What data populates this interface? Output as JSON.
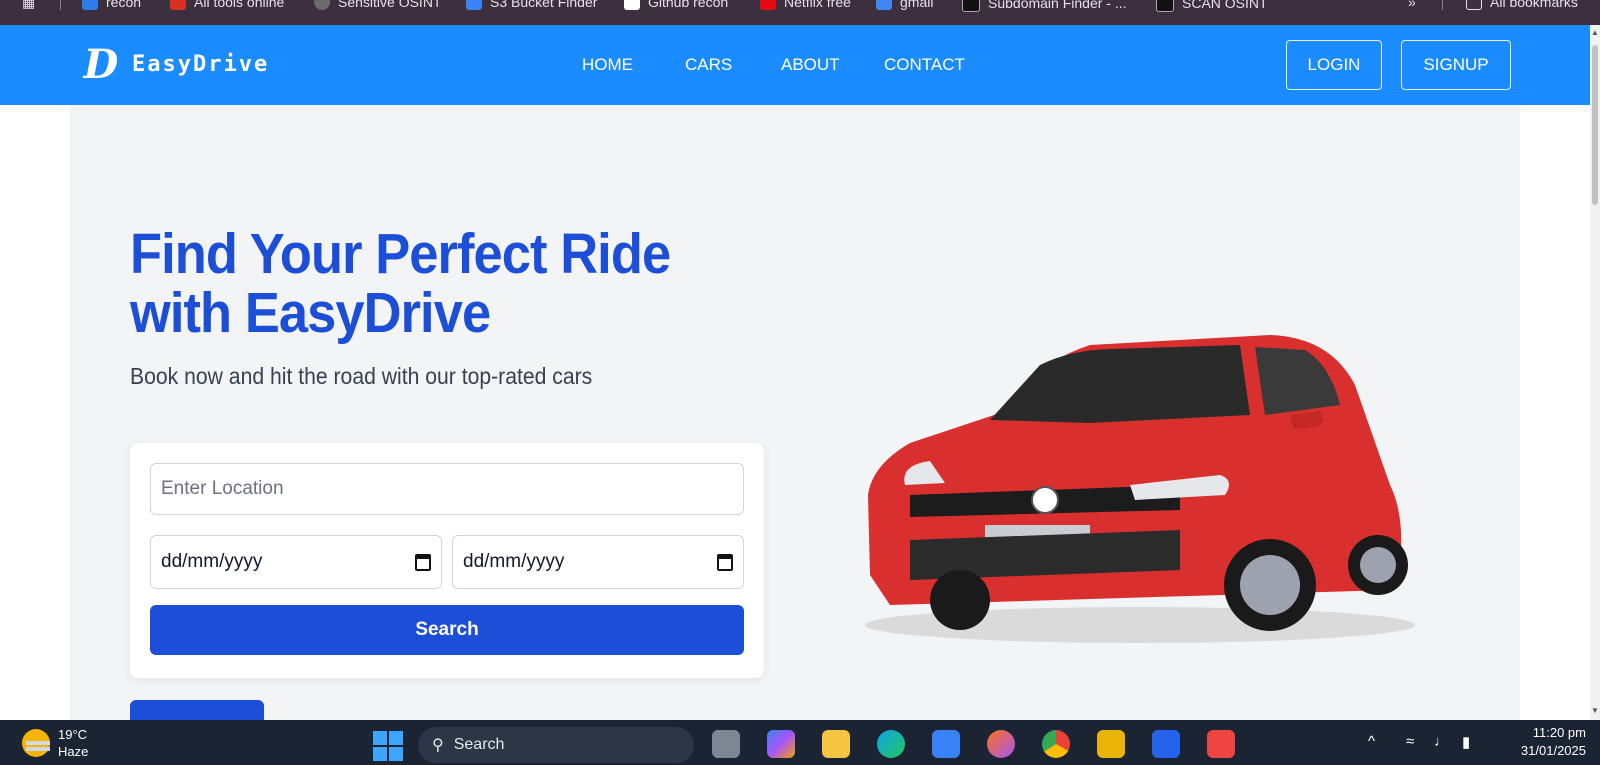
{
  "bookmarks": [
    {
      "label": "recon",
      "color": "#2b7de9"
    },
    {
      "label": "All tools online",
      "color": "#d93025"
    },
    {
      "label": "Sensitive OSINT",
      "color": "#6b6b6b"
    },
    {
      "label": "S3 Bucket Finder",
      "color": "#3b82f6"
    },
    {
      "label": "Github recon",
      "color": "#ffffff"
    },
    {
      "label": "Netflix free",
      "color": "#e50914"
    },
    {
      "label": "gmail",
      "color": "#4285f4"
    },
    {
      "label": "Subdomain Finder - ...",
      "color": "#111111"
    },
    {
      "label": "SCAN OSINT",
      "color": "#111111"
    }
  ],
  "bookmarks_more": "»",
  "bookmarks_all": "All bookmarks",
  "brand": {
    "mark": "D",
    "name": "EasyDrive"
  },
  "nav": {
    "links": [
      "HOME",
      "CARS",
      "ABOUT",
      "CONTACT"
    ],
    "login": "LOGIN",
    "signup": "SIGNUP"
  },
  "hero": {
    "title_line1": "Find Your Perfect Ride",
    "title_line2": "with EasyDrive",
    "subtitle": "Book now and hit the road with our top-rated cars"
  },
  "search_form": {
    "location_placeholder": "Enter Location",
    "pickup_date": "dd/mm/yyyy",
    "return_date": "dd/mm/yyyy",
    "button": "Search"
  },
  "colors": {
    "navbar": "#1a8cff",
    "accent": "#1d4ed8",
    "hero_bg": "#f3f4f6",
    "car_body": "#d92f2f"
  },
  "taskbar": {
    "temperature": "19°C",
    "weather": "Haze",
    "search_label": "Search",
    "time": "11:20 pm",
    "date": "31/01/2025"
  }
}
